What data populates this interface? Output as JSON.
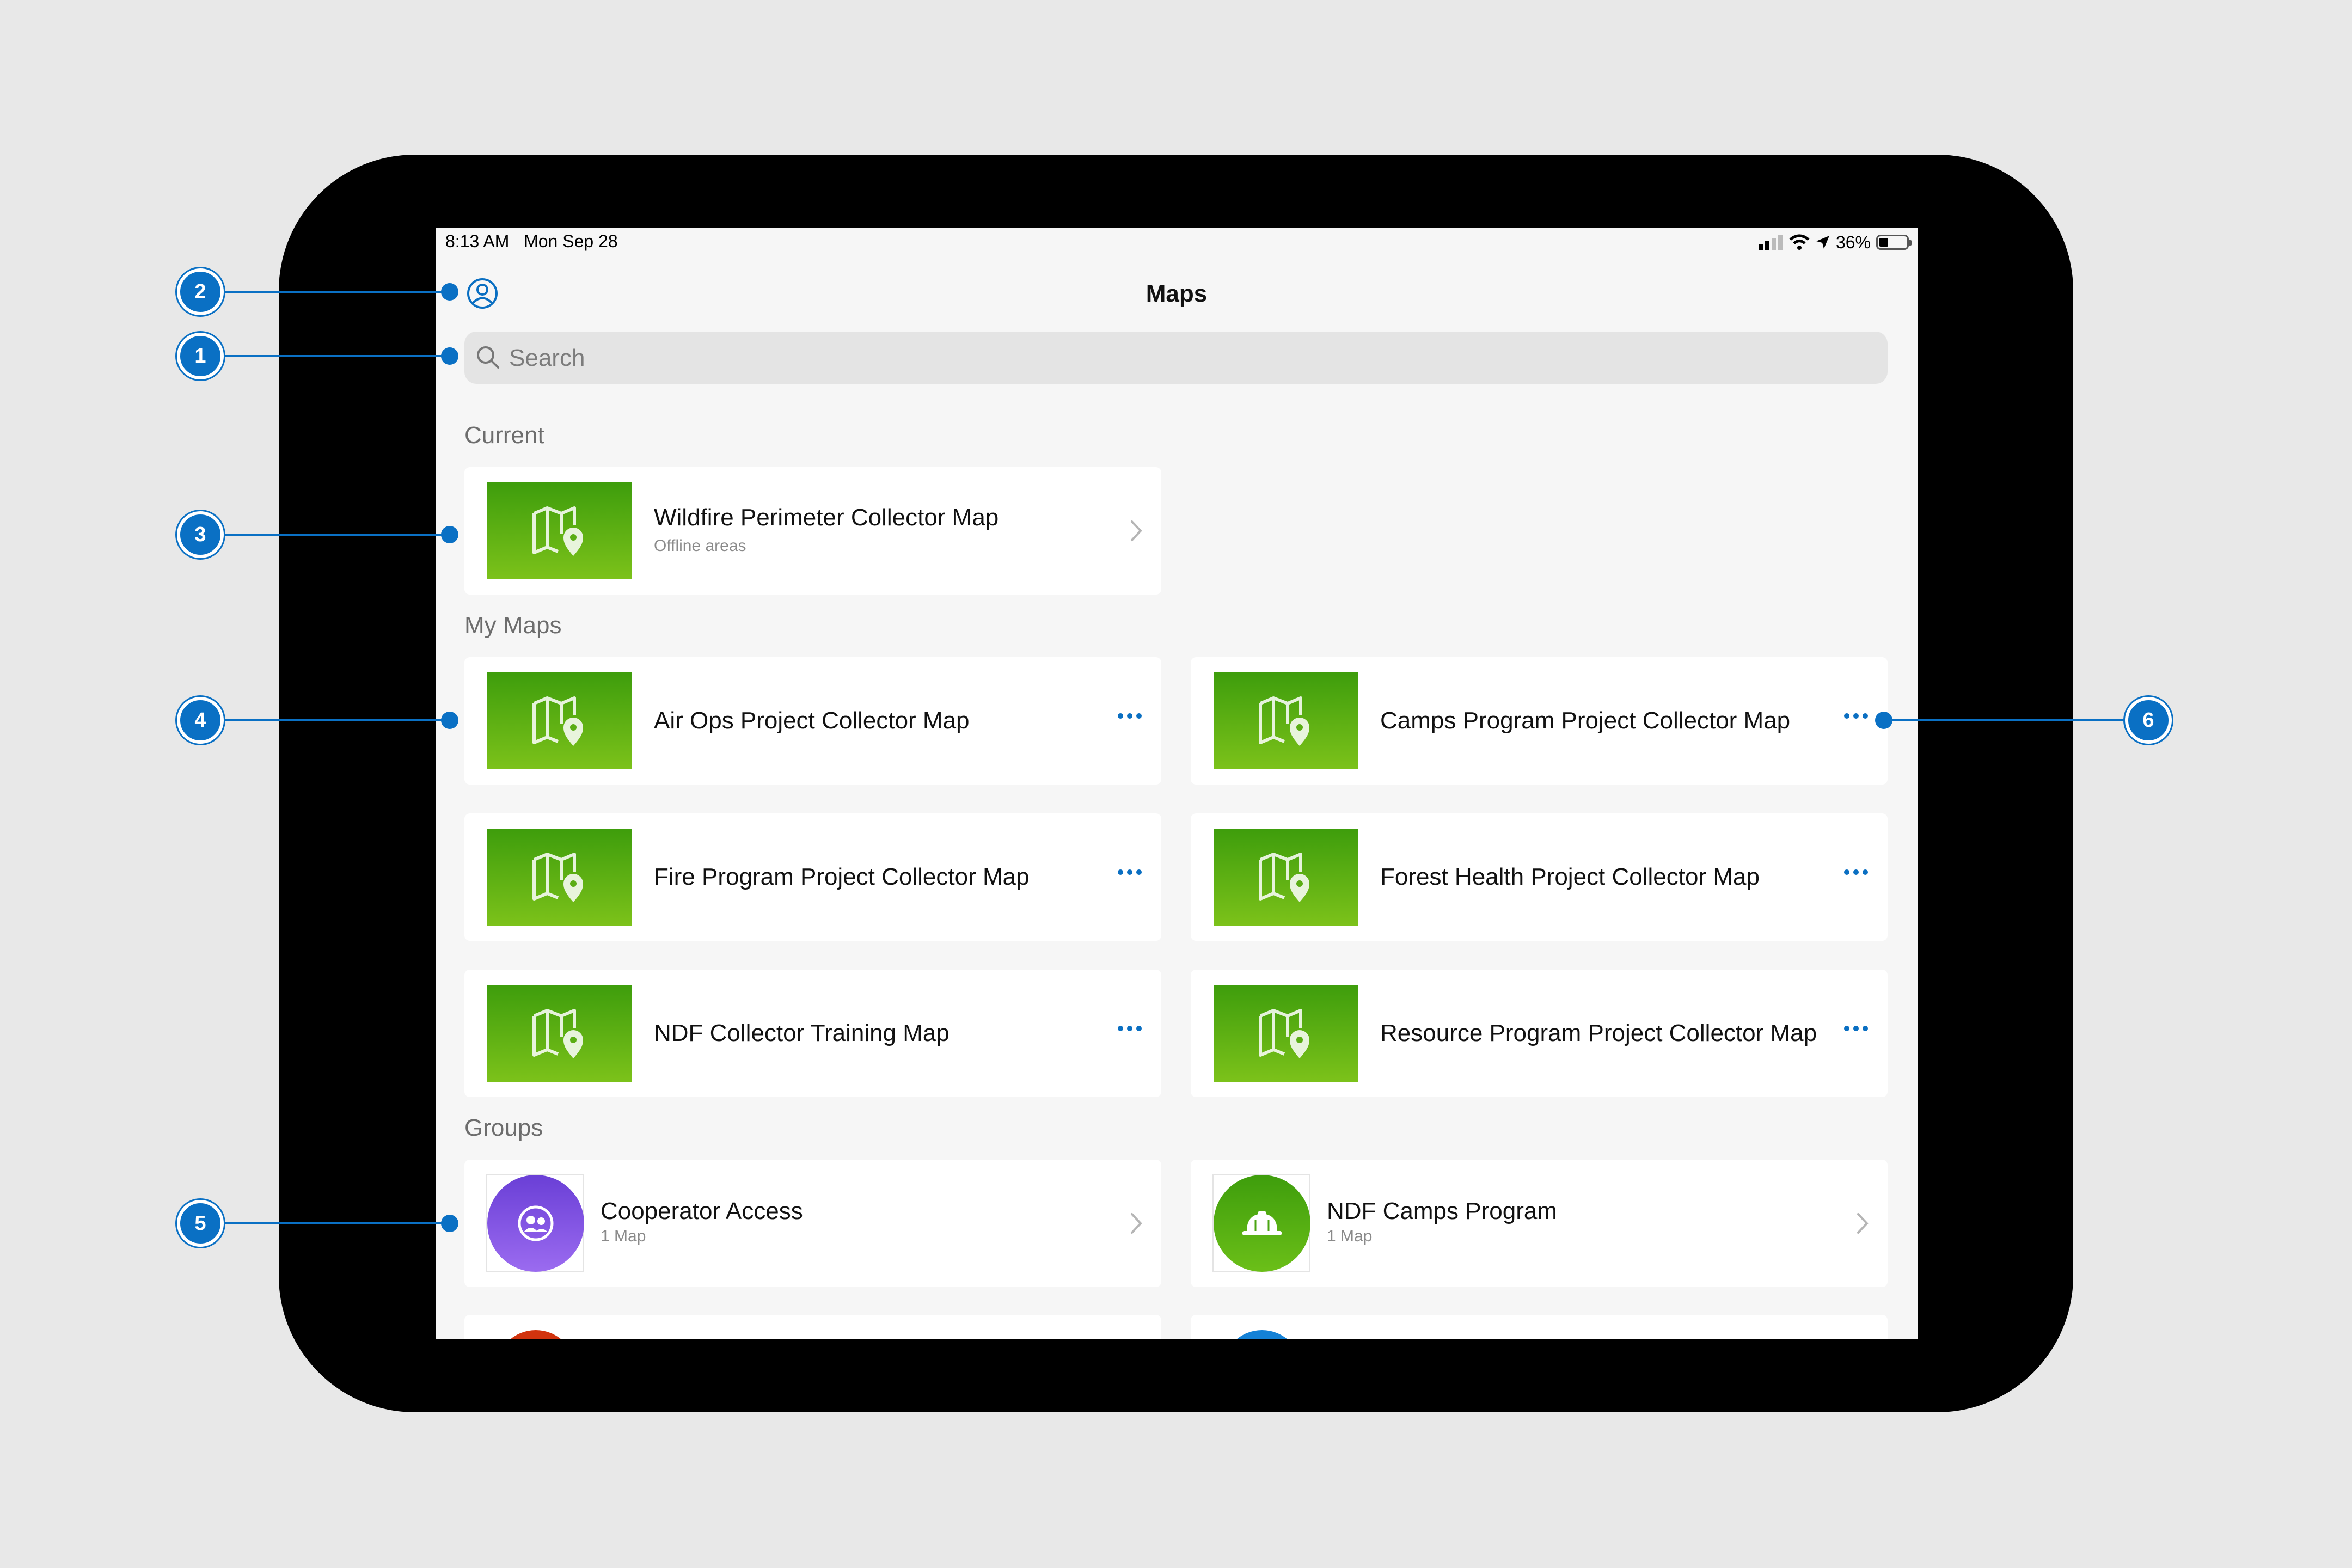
{
  "status_bar": {
    "time": "8:13 AM",
    "date": "Mon Sep 28",
    "battery": "36%",
    "battery_level": 0.36
  },
  "nav": {
    "title": "Maps",
    "profile_icon": "profile-icon"
  },
  "search": {
    "placeholder": "Search",
    "icon": "search-icon"
  },
  "sections": {
    "current": "Current",
    "my_maps": "My Maps",
    "groups": "Groups"
  },
  "current_map": {
    "title": "Wildfire Perimeter Collector Map",
    "subtitle": "Offline areas"
  },
  "my_maps": [
    {
      "title": "Air Ops Project Collector Map"
    },
    {
      "title": "Camps Program Project Collector Map"
    },
    {
      "title": "Fire Program Project Collector Map"
    },
    {
      "title": "Forest Health Project Collector Map"
    },
    {
      "title": "NDF Collector Training Map"
    },
    {
      "title": "Resource Program Project Collector Map"
    }
  ],
  "groups": [
    {
      "title": "Cooperator Access",
      "subtitle": "1 Map",
      "color": "#7b4fe0",
      "icon": "people-icon"
    },
    {
      "title": "NDF Camps Program",
      "subtitle": "1 Map",
      "color": "#3e9d0c",
      "icon": "hard-hat-icon"
    }
  ],
  "callouts": [
    "1",
    "2",
    "3",
    "4",
    "5",
    "6"
  ],
  "colors": {
    "accent": "#0a70c4",
    "map_thumb_top": "#3e9d0c",
    "map_thumb_bottom": "#7cc21a"
  }
}
